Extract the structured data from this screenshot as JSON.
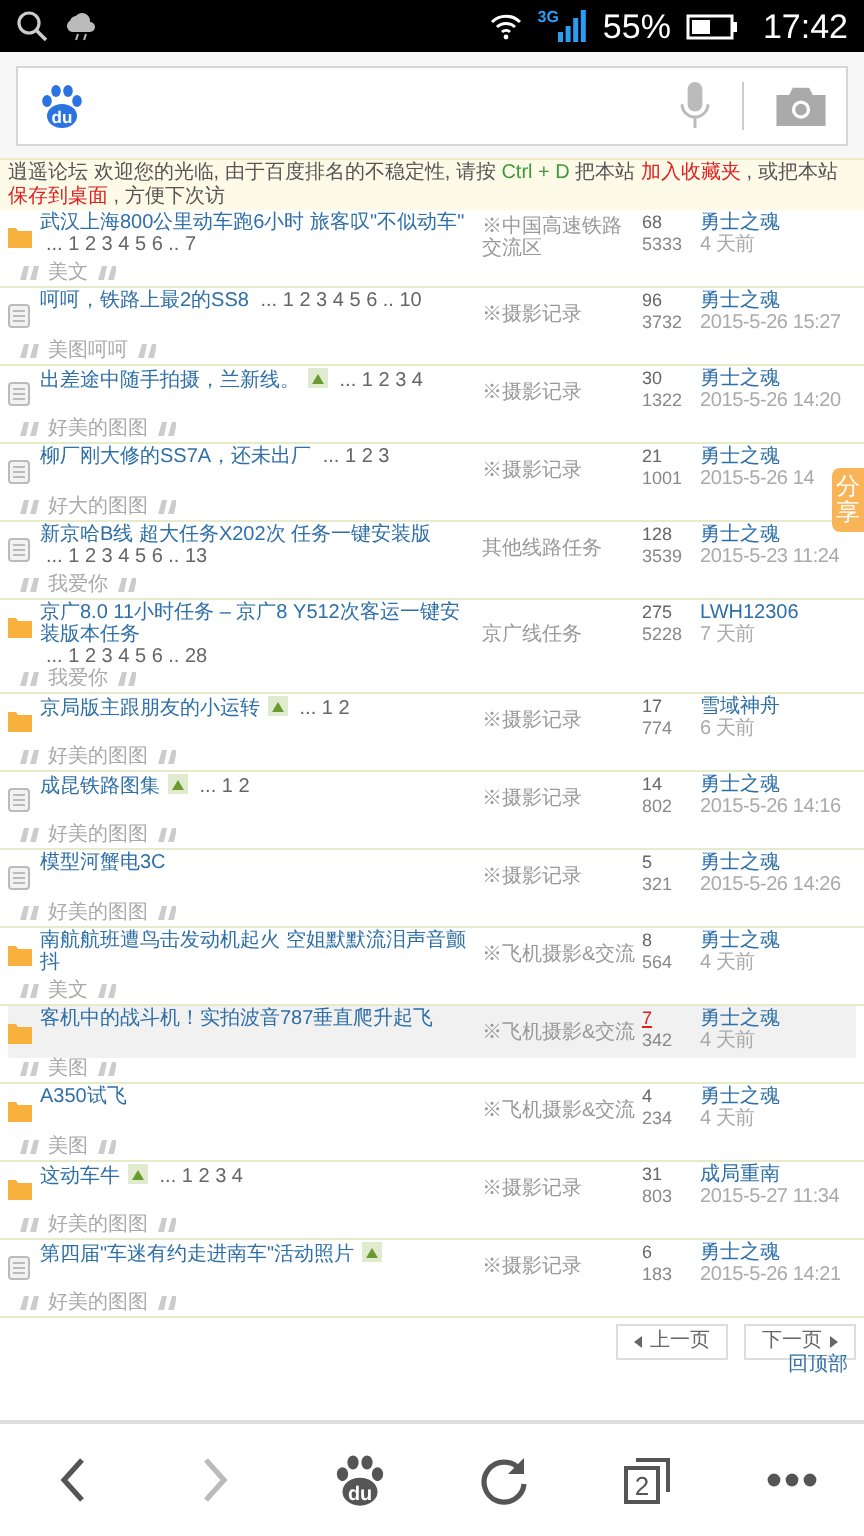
{
  "status_bar": {
    "network": "3G",
    "battery": "55%",
    "time": "17:42"
  },
  "search_bar": {
    "logo_text": "du"
  },
  "notice": [
    {
      "kind": "plain",
      "text": "逍遥论坛 欢迎您的光临, 由于百度排名的不稳定性, 请按"
    },
    {
      "kind": "key",
      "text": "Ctrl + D"
    },
    {
      "kind": "plain",
      "text": "把本站"
    },
    {
      "kind": "link",
      "text": "加入收藏夹"
    },
    {
      "kind": "plain",
      "text": ", 或把本站"
    },
    {
      "kind": "link",
      "text": "保存到桌面"
    },
    {
      "kind": "plain",
      "text": ", 方便下次访"
    }
  ],
  "threads": [
    {
      "kind": "folder",
      "title": "武汉上海800公里动车跑6小时 旅客叹\"不似动车\"",
      "image": false,
      "pages": "... 1 2 3 4 5 6 .. 7",
      "forum": "※中国高速铁路交流区",
      "replies": "68",
      "hot": false,
      "views": "5333",
      "author": "勇士之魂",
      "time": "4 天前",
      "highlighted": false,
      "tag": "美文"
    },
    {
      "kind": "doc",
      "title": "呵呵，铁路上最2的SS8",
      "image": false,
      "pages": "... 1 2 3 4 5 6 .. 10",
      "forum": "※摄影记录",
      "replies": "96",
      "hot": false,
      "views": "3732",
      "author": "勇士之魂",
      "time": "2015-5-26 15:27",
      "highlighted": false,
      "tag": "美图呵呵"
    },
    {
      "kind": "doc",
      "title": "出差途中随手拍摄，兰新线。",
      "image": true,
      "pages": "... 1 2 3 4",
      "forum": "※摄影记录",
      "replies": "30",
      "hot": false,
      "views": "1322",
      "author": "勇士之魂",
      "time": "2015-5-26 14:20",
      "highlighted": false,
      "tag": "好美的图图"
    },
    {
      "kind": "doc",
      "title": "柳厂刚大修的SS7A，还未出厂",
      "image": false,
      "pages": "... 1 2 3",
      "forum": "※摄影记录",
      "replies": "21",
      "hot": false,
      "views": "1001",
      "author": "勇士之魂",
      "time": "2015-5-26 14",
      "highlighted": false,
      "tag": "好大的图图"
    },
    {
      "kind": "doc",
      "title": "新京哈B线 超大任务X202次 任务一键安装版",
      "image": false,
      "pages": "... 1 2 3 4 5 6 .. 13",
      "forum": "其他线路任务",
      "replies": "128",
      "hot": false,
      "views": "3539",
      "author": "勇士之魂",
      "time": "2015-5-23 11:24",
      "highlighted": false,
      "tag": "我爱你"
    },
    {
      "kind": "folder",
      "title": "京广8.0 11小时任务 – 京广8 Y512次客运一键安装版本任务",
      "image": false,
      "pages": "... 1 2 3 4 5 6 .. 28",
      "forum": "京广线任务",
      "replies": "275",
      "hot": false,
      "views": "5228",
      "author": "LWH12306",
      "time": "7 天前",
      "highlighted": false,
      "tag": "我爱你"
    },
    {
      "kind": "folder",
      "title": "京局版主跟朋友的小运转",
      "image": true,
      "pages": "... 1 2",
      "forum": "※摄影记录",
      "replies": "17",
      "hot": false,
      "views": "774",
      "author": "雪域神舟",
      "time": "6 天前",
      "highlighted": false,
      "tag": "好美的图图"
    },
    {
      "kind": "doc",
      "title": "成昆铁路图集",
      "image": true,
      "pages": "... 1 2",
      "forum": "※摄影记录",
      "replies": "14",
      "hot": false,
      "views": "802",
      "author": "勇士之魂",
      "time": "2015-5-26 14:16",
      "highlighted": false,
      "tag": "好美的图图"
    },
    {
      "kind": "doc",
      "title": "模型河蟹电3C",
      "image": false,
      "forum": "※摄影记录",
      "replies": "5",
      "hot": false,
      "views": "321",
      "author": "勇士之魂",
      "time": "2015-5-26 14:26",
      "highlighted": false,
      "tag": "好美的图图"
    },
    {
      "kind": "folder",
      "title": "南航航班遭鸟击发动机起火 空姐默默流泪声音颤抖",
      "image": false,
      "forum": "※飞机摄影&交流",
      "replies": "8",
      "hot": false,
      "views": "564",
      "author": "勇士之魂",
      "time": "4 天前",
      "highlighted": false,
      "tag": "美文"
    },
    {
      "kind": "folder",
      "title": "客机中的战斗机！实拍波音787垂直爬升起飞",
      "image": false,
      "forum": "※飞机摄影&交流",
      "replies": "7",
      "hot": true,
      "views": "342",
      "author": "勇士之魂",
      "time": "4 天前",
      "highlighted": true,
      "tag": "美图"
    },
    {
      "kind": "folder",
      "title": "A350试飞",
      "image": false,
      "forum": "※飞机摄影&交流",
      "replies": "4",
      "hot": false,
      "views": "234",
      "author": "勇士之魂",
      "time": "4 天前",
      "highlighted": false,
      "tag": "美图"
    },
    {
      "kind": "folder",
      "title": "这动车牛",
      "image": true,
      "pages": "... 1 2 3 4",
      "forum": "※摄影记录",
      "replies": "31",
      "hot": false,
      "views": "803",
      "author": "成局重南",
      "time": "2015-5-27 11:34",
      "highlighted": false,
      "tag": "好美的图图"
    },
    {
      "kind": "doc",
      "title": "第四届\"车迷有约走进南车\"活动照片",
      "image": true,
      "forum": "※摄影记录",
      "replies": "6",
      "hot": false,
      "views": "183",
      "author": "勇士之魂",
      "time": "2015-5-26 14:21",
      "highlighted": false,
      "tag": "好美的图图"
    }
  ],
  "share_tab": "分享",
  "pager": {
    "prev": "上一页",
    "next": "下一页",
    "back_to_top": "回顶部"
  },
  "bottom_nav": {
    "back_disabled": false,
    "forward_disabled": true,
    "logo_text": "du",
    "tab_count": "2"
  }
}
